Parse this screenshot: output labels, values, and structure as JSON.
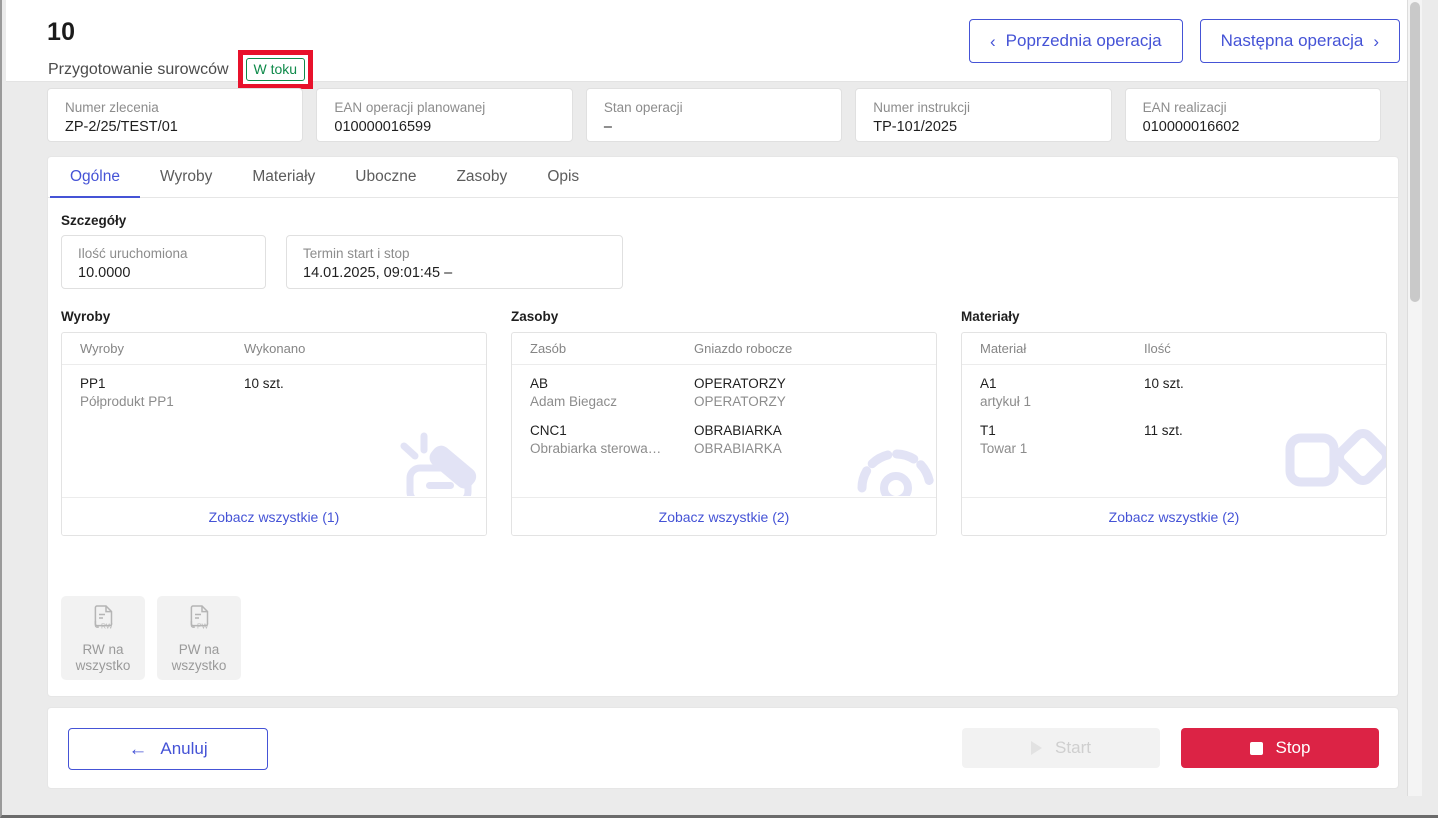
{
  "header": {
    "operation_number": "10",
    "operation_title": "Przygotowanie surowców",
    "status_badge": "W toku",
    "status_badge_color": "#0f8a4a",
    "annotation_color": "#e8112b",
    "prev_button": "Poprzednia operacja",
    "next_button": "Następna operacja",
    "prev_chevron": "‹",
    "next_chevron": "›"
  },
  "info_cards": [
    {
      "label": "Numer zlecenia",
      "value": "ZP-2/25/TEST/01"
    },
    {
      "label": "EAN operacji planowanej",
      "value": "010000016599"
    },
    {
      "label": "Stan operacji",
      "value": "–"
    },
    {
      "label": "Numer instrukcji",
      "value": "TP-101/2025"
    },
    {
      "label": "EAN realizacji",
      "value": "010000016602"
    }
  ],
  "tabs": [
    {
      "label": "Ogólne",
      "active": true
    },
    {
      "label": "Wyroby",
      "active": false
    },
    {
      "label": "Materiały",
      "active": false
    },
    {
      "label": "Uboczne",
      "active": false
    },
    {
      "label": "Zasoby",
      "active": false
    },
    {
      "label": "Opis",
      "active": false
    }
  ],
  "details": {
    "title": "Szczegóły",
    "fields": [
      {
        "label": "Ilość uruchomiona",
        "value": "10.0000"
      },
      {
        "label": "Termin start i stop",
        "value": "14.01.2025, 09:01:45 –"
      }
    ]
  },
  "tables": [
    {
      "heading": "Wyroby",
      "col1": "Wyroby",
      "col2": "Wykonano",
      "rows": [
        {
          "main": "PP1",
          "sub": "Półprodukt PP1",
          "value": "10 szt."
        }
      ],
      "footer_link": "Zobacz wszystkie (1)",
      "watermark": "scanner-icon"
    },
    {
      "heading": "Zasoby",
      "col1": "Zasób",
      "col2": "Gniazdo robocze",
      "rows": [
        {
          "main": "AB",
          "sub": "Adam Biegacz",
          "value": "OPERATORZY",
          "value_sub": "OPERATORZY"
        },
        {
          "main": "CNC1",
          "sub": "Obrabiarka sterowa…",
          "value": "OBRABIARKA",
          "value_sub": "OBRABIARKA"
        }
      ],
      "footer_link": "Zobacz wszystkie (2)",
      "watermark": "gauge-icon"
    },
    {
      "heading": "Materiały",
      "col1": "Materiał",
      "col2": "Ilość",
      "rows": [
        {
          "main": "A1",
          "sub": "artykuł 1",
          "value": "10 szt."
        },
        {
          "main": "T1",
          "sub": "Towar 1",
          "value": "11 szt."
        }
      ],
      "footer_link": "Zobacz wszystkie (2)",
      "watermark": "shapes-icon"
    }
  ],
  "doc_buttons": [
    {
      "icon_label": "RW",
      "label_line1": "RW na",
      "label_line2": "wszystko"
    },
    {
      "icon_label": "PW",
      "label_line1": "PW na",
      "label_line2": "wszystko"
    }
  ],
  "bottom_bar": {
    "cancel_label": "Anuluj",
    "cancel_arrow": "←",
    "start_label": "Start",
    "stop_label": "Stop",
    "stop_color": "#dc2345",
    "accent_color": "#4553d6"
  }
}
